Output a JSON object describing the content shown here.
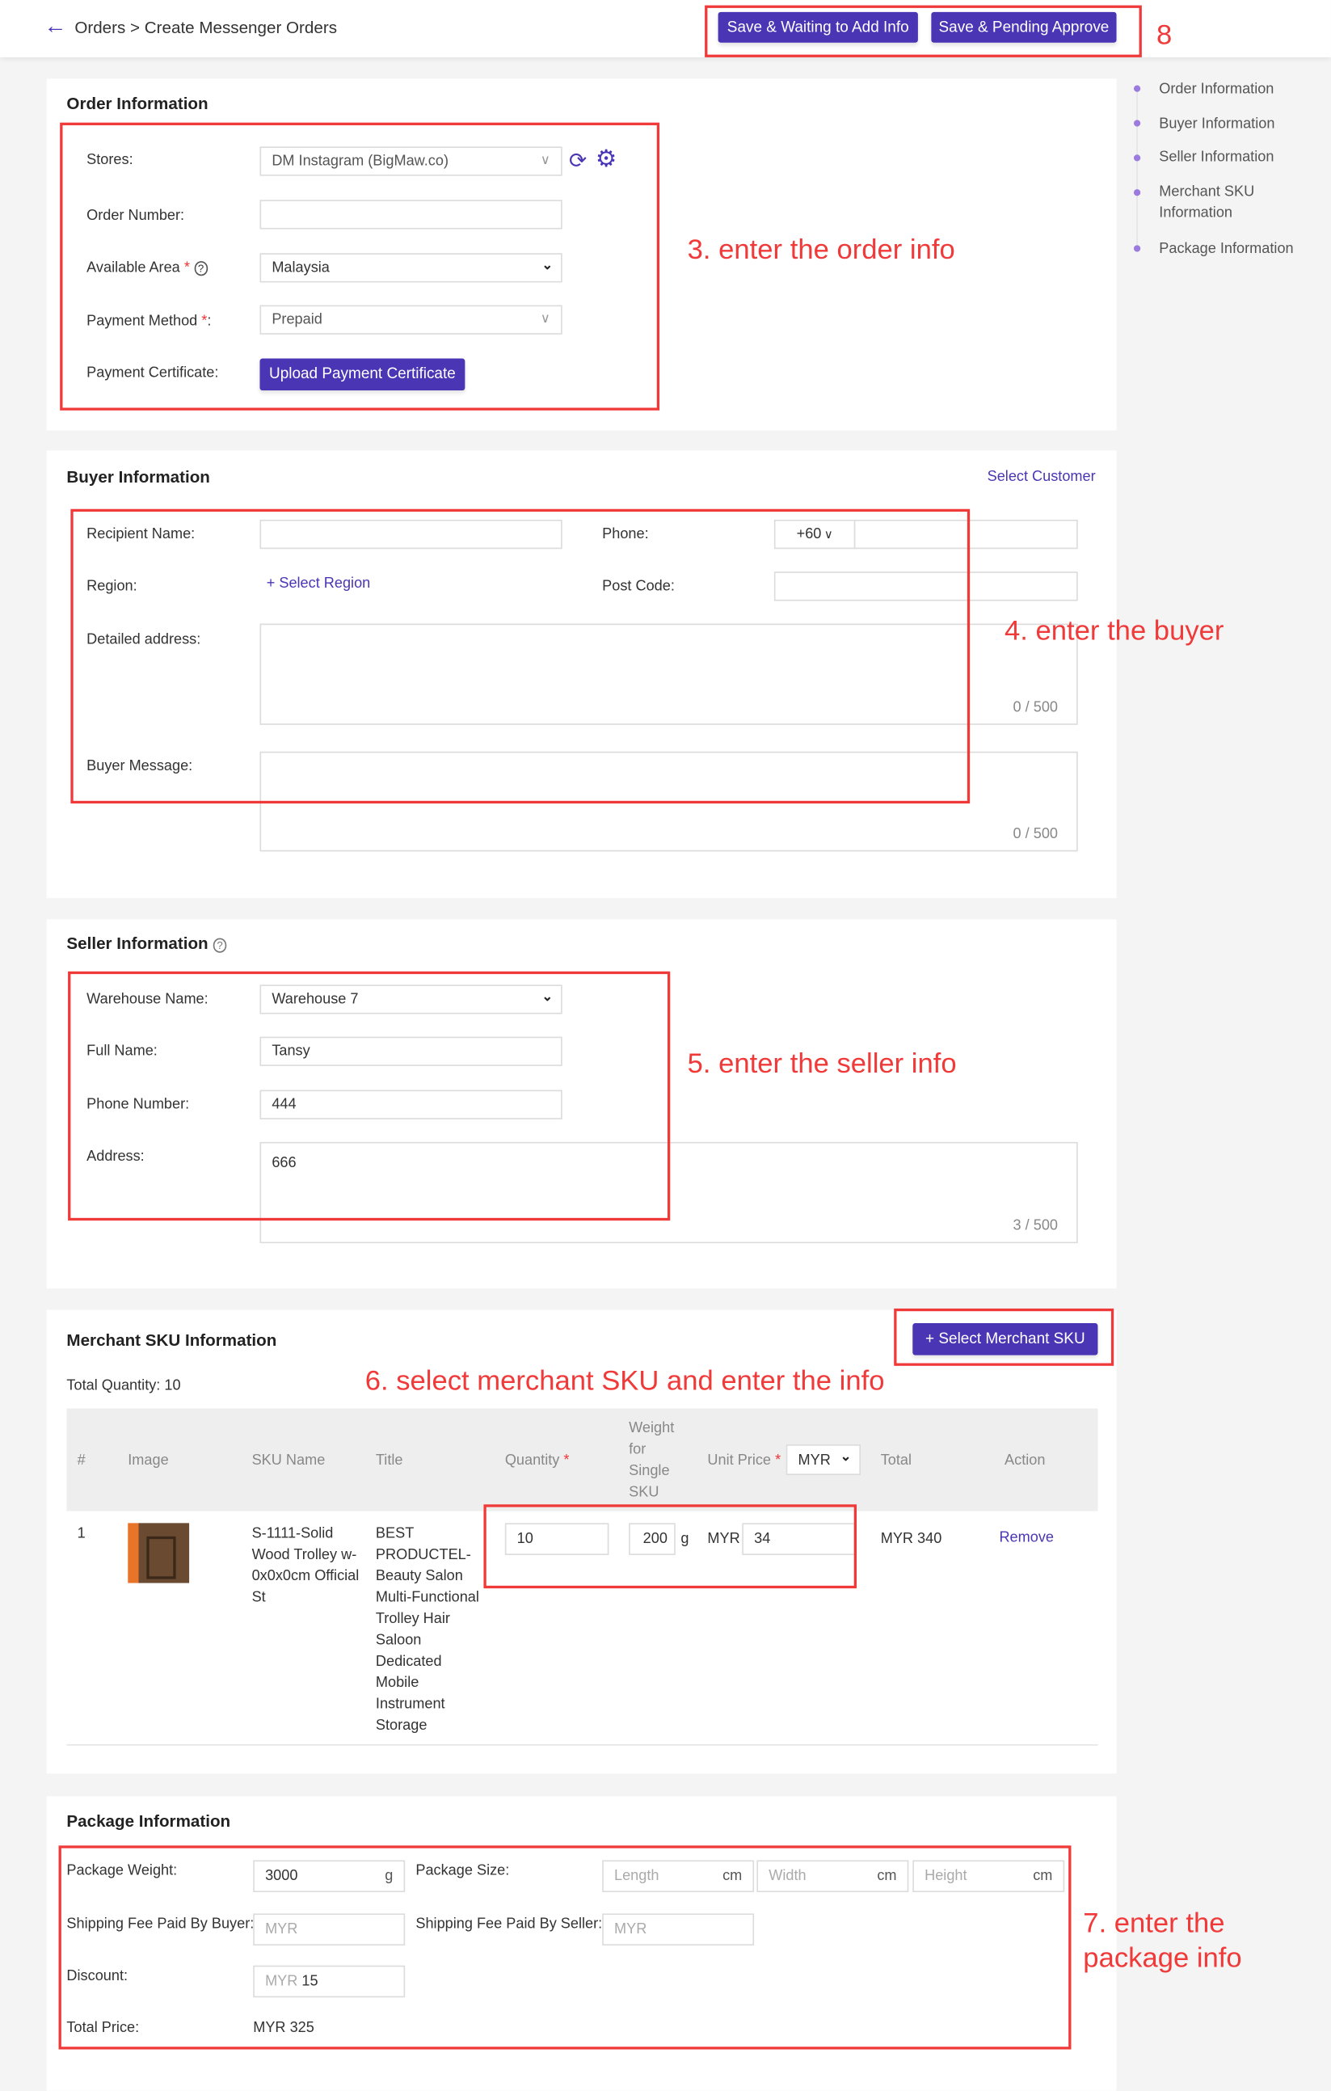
{
  "header": {
    "breadcrumb": "Orders > Create Messenger Orders",
    "save_waiting": "Save & Waiting to Add Info",
    "save_pending": "Save & Pending Approve"
  },
  "annotations": {
    "a8": "8",
    "a3": "3. enter the order info",
    "a4": "4. enter the buyer",
    "a5": "5. enter the seller info",
    "a6": "6. select merchant SKU and enter the info",
    "a7_1": "7. enter the",
    "a7_2": "package info"
  },
  "nav": [
    "Order Information",
    "Buyer Information",
    "Seller Information",
    "Merchant SKU",
    "Information",
    "Package Information"
  ],
  "order": {
    "title": "Order Information",
    "stores_label": "Stores:",
    "stores_value": "DM Instagram (BigMaw.co)",
    "order_number_label": "Order Number:",
    "area_label": "Available Area",
    "area_value": "Malaysia",
    "payment_label": "Payment Method",
    "payment_value": "Prepaid",
    "cert_label": "Payment Certificate:",
    "upload": "Upload Payment Certificate",
    "req": "*"
  },
  "buyer": {
    "title": "Buyer Information",
    "select_customer": "Select Customer",
    "recipient_label": "Recipient Name:",
    "phone_label": "Phone:",
    "phone_code": "+60",
    "region_label": "Region:",
    "select_region": "+ Select Region",
    "postcode_label": "Post Code:",
    "address_label": "Detailed address:",
    "address_count": "0 / 500",
    "message_label": "Buyer Message:",
    "message_count": "0 / 500"
  },
  "seller": {
    "title": "Seller Information",
    "warehouse_label": "Warehouse Name:",
    "warehouse_value": "Warehouse 7",
    "fullname_label": "Full Name:",
    "fullname_value": "Tansy",
    "phone_label": "Phone Number:",
    "phone_value": "444",
    "address_label": "Address:",
    "address_value": "666",
    "address_count": "3 / 500"
  },
  "sku": {
    "title": "Merchant SKU Information",
    "select_button": "+ Select Merchant SKU",
    "total_quantity": "Total Quantity: 10",
    "columns": [
      "#",
      "Image",
      "SKU Name",
      "Title",
      "Quantity",
      "Weight for Single SKU",
      "Unit Price",
      "Total",
      "Action"
    ],
    "weight_lines": [
      "Weight",
      "for",
      "Single",
      "SKU"
    ],
    "currency": "MYR",
    "rows": [
      {
        "index": "1",
        "sku_name": "S-1111-Solid Wood Trolley w-0x0x0cm Official St",
        "title": "BEST PRODUCTEL-Beauty Salon Multi-Functional Trolley Hair Saloon Dedicated Mobile Instrument Storage",
        "quantity": "10",
        "weight": "200",
        "weight_unit": "g",
        "price_currency": "MYR",
        "unit_price": "34",
        "total": "MYR 340",
        "action": "Remove"
      }
    ]
  },
  "package": {
    "title": "Package Information",
    "weight_label": "Package Weight:",
    "weight_value": "3000",
    "weight_unit": "g",
    "size_label": "Package Size:",
    "length_ph": "Length",
    "width_ph": "Width",
    "height_ph": "Height",
    "cm": "cm",
    "buyer_fee_label": "Shipping Fee Paid By Buyer:",
    "seller_fee_label": "Shipping Fee Paid By Seller:",
    "myr": "MYR",
    "discount_label": "Discount:",
    "discount_value": "15",
    "total_label": "Total Price:",
    "total_value": "MYR 325"
  },
  "colors": {
    "primary": "#4a35b5",
    "annotation": "#f03a3a"
  }
}
